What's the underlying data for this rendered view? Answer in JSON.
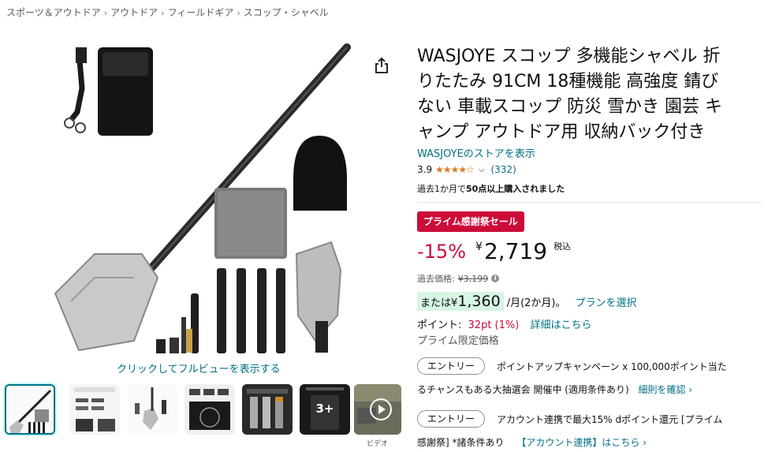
{
  "breadcrumb": {
    "items": [
      "スポーツ＆アウトドア",
      "アウトドア",
      "フィールドギア",
      "スコップ・シャベル"
    ],
    "separator": "›"
  },
  "gallery": {
    "fullview_link": "クリックしてフルビューを表示する",
    "thumbnails": [
      {
        "name": "thumb-1",
        "selected": true,
        "overlay": ""
      },
      {
        "name": "thumb-2",
        "selected": false,
        "overlay": ""
      },
      {
        "name": "thumb-3",
        "selected": false,
        "overlay": ""
      },
      {
        "name": "thumb-4",
        "selected": false,
        "overlay": ""
      },
      {
        "name": "thumb-5",
        "selected": false,
        "overlay": ""
      },
      {
        "name": "thumb-6",
        "selected": false,
        "overlay": "3+"
      },
      {
        "name": "thumb-video",
        "selected": false,
        "overlay": ""
      }
    ],
    "more_count": "3+",
    "video_label": "ビデオ",
    "icons": {
      "share": "share-icon",
      "play": "play-icon"
    }
  },
  "product": {
    "title_lines": [
      "WASJOYE スコップ 多機能シャベル 折",
      "りたたみ 91CM 18種機能 高強度 錆び",
      "ない 車載スコップ 防災 雪かき 園芸 キ",
      "ャンプ アウトドア用 収納バック付き"
    ],
    "store_link": "WASJOYEのストアを表示",
    "rating": "3.9",
    "rating_value": 3.9,
    "stars": "★★★★☆",
    "review_count": "(332)",
    "bought_prefix": "過去1か月で",
    "bought_bold": "50点以上購入されました"
  },
  "pricing": {
    "deal_badge": "プライム感謝祭セール",
    "discount": "-15%",
    "currency": "¥",
    "price": "2,719",
    "tax_label": "税込",
    "list_price_label": "過去価格:",
    "list_price": "¥3,199",
    "installment_prefix": "または¥",
    "installment_amount": "1,360",
    "installment_suffix": "/月(2か月)。",
    "plan_link": "プランを選択",
    "points_label": "ポイント:",
    "points_value": "32pt  (1%)",
    "points_link": "詳細はこちら",
    "prime_only": "プライム限定価格"
  },
  "promotions": [
    {
      "button": "エントリー",
      "line1": "ポイントアップキャンペーン x 100,000ポイント当た",
      "line2": "るチャンスもある大抽選会 開催中 (適用条件あり)",
      "link": "細則を確認 ›"
    },
    {
      "button": "エントリー",
      "line1": "アカウント連携で最大15% dポイント還元 [プライム",
      "line2": "感謝祭] *諸条件あり",
      "link": "【アカウント連携】はこちら ›"
    }
  ],
  "colors": {
    "link": "#007185",
    "deal": "#cc0c39",
    "star": "#de7921",
    "installment_bg": "#d7f5e3"
  }
}
